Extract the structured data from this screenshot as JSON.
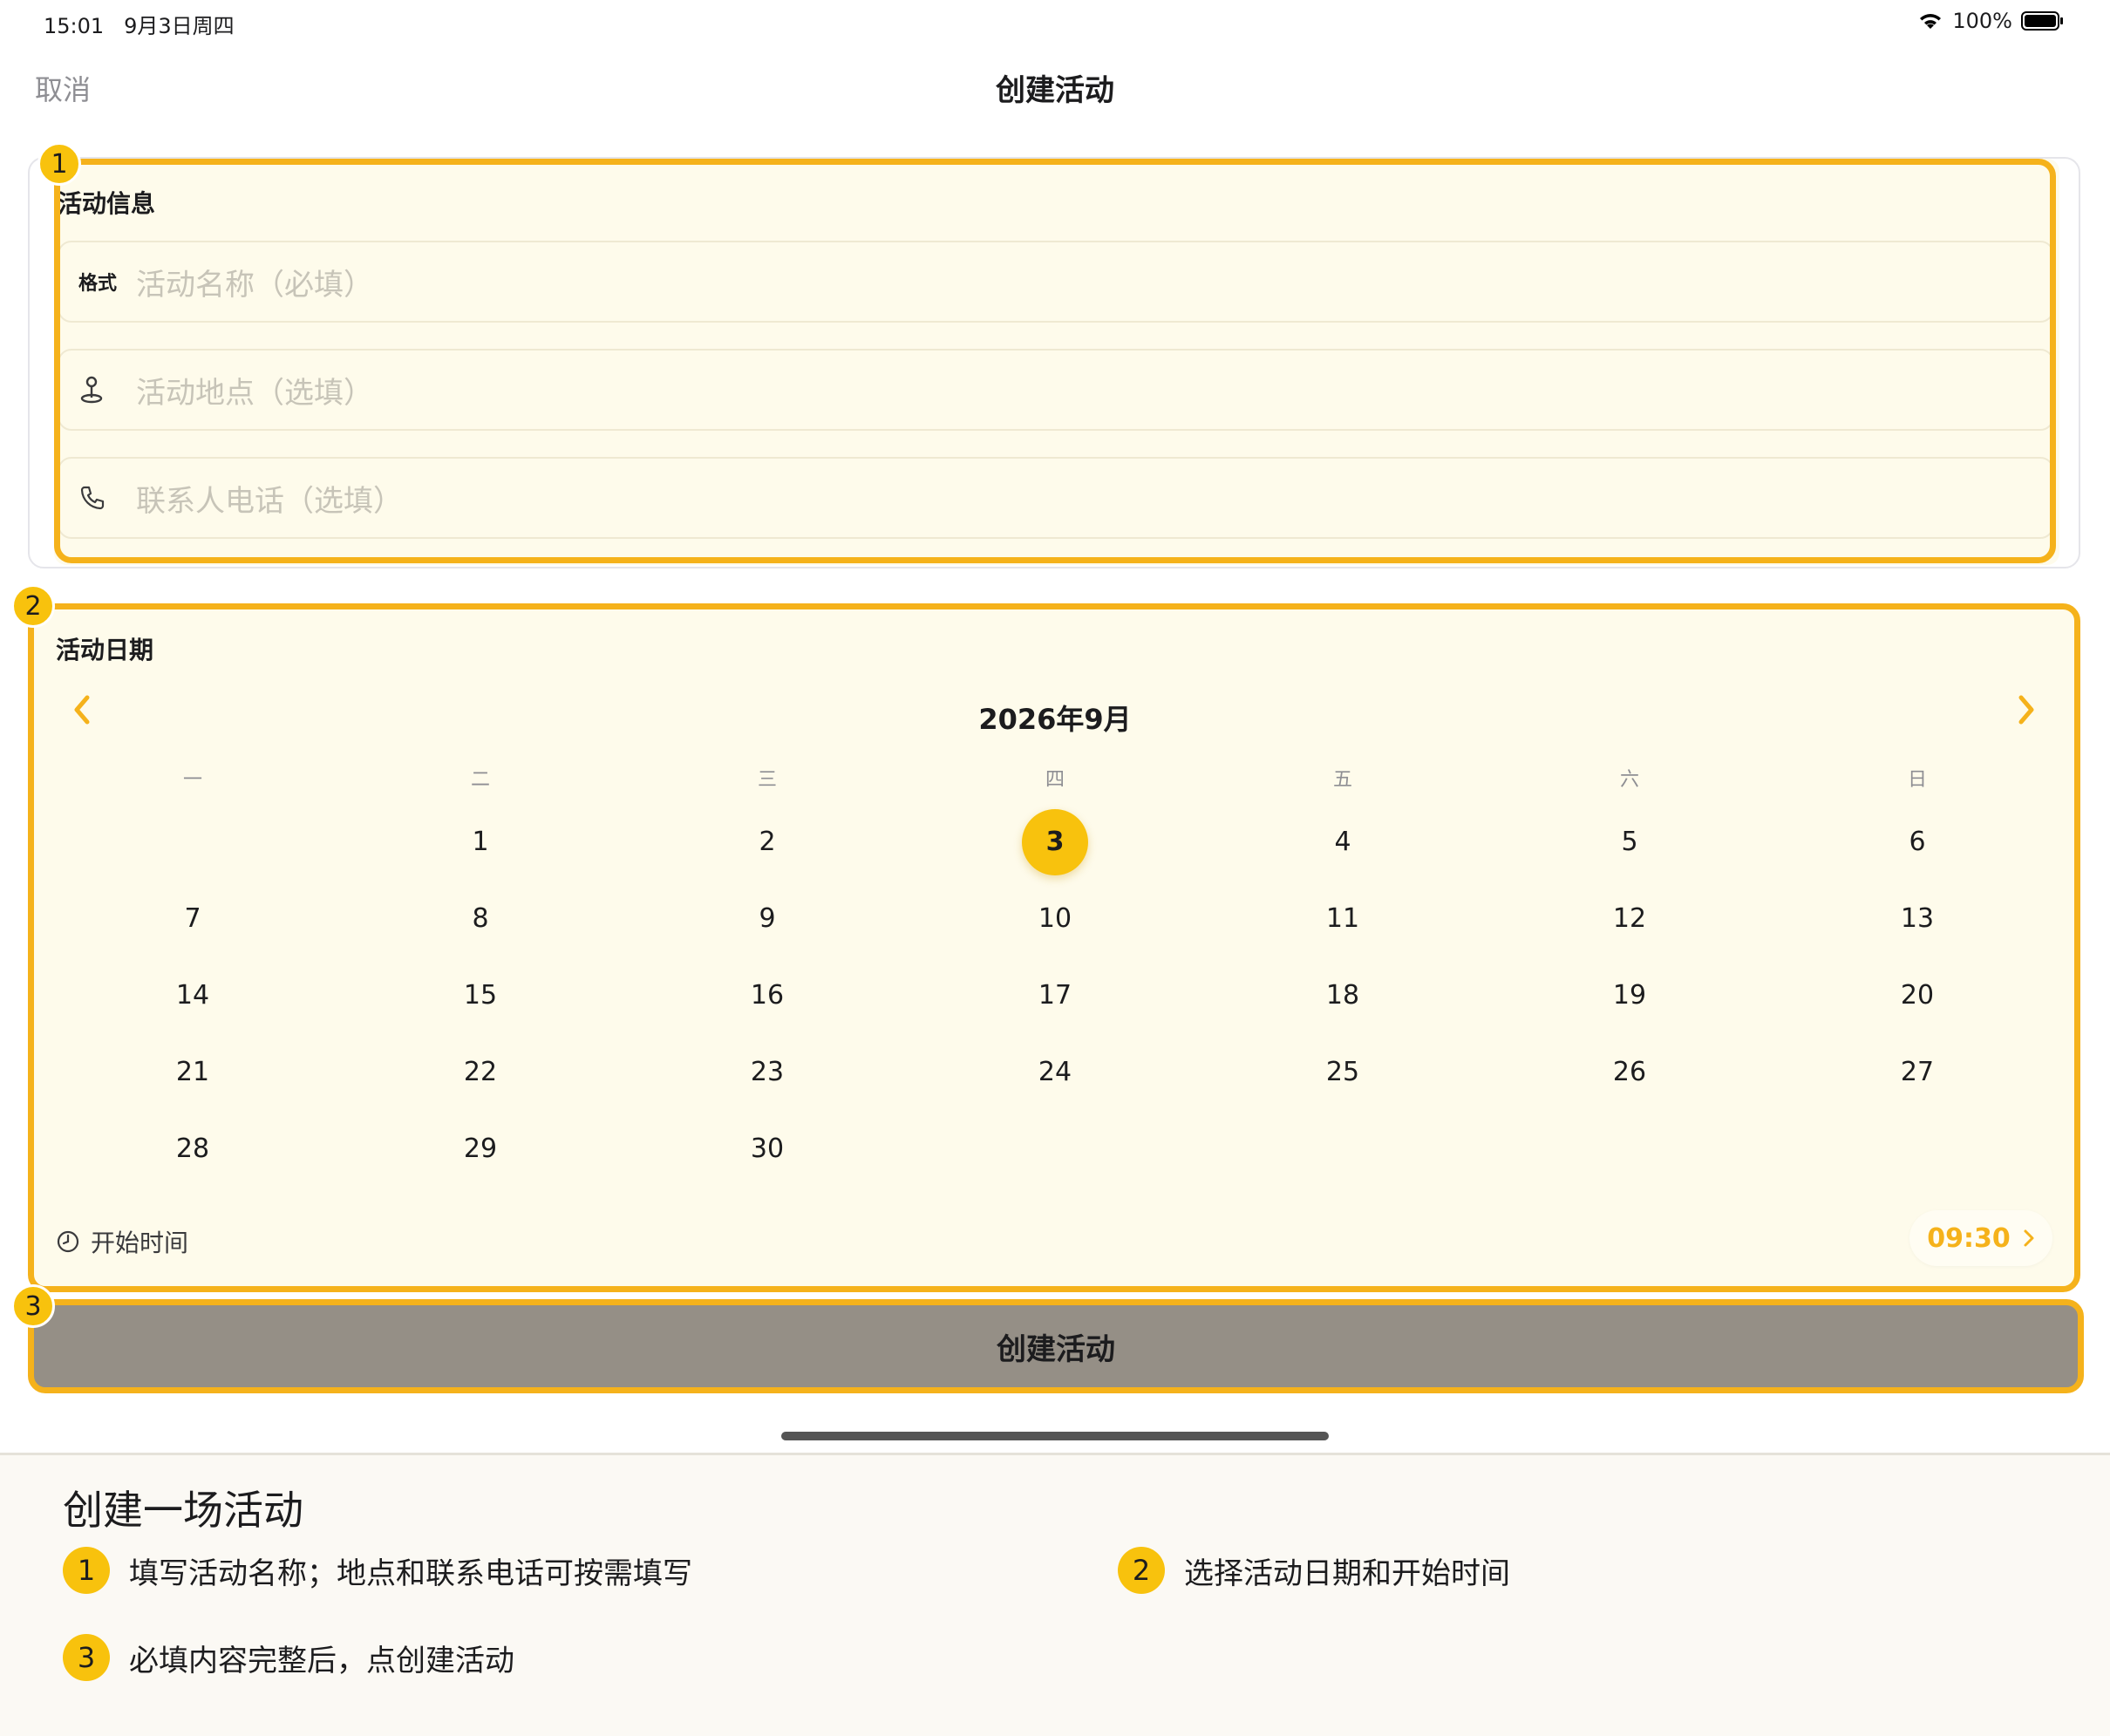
{
  "status_bar": {
    "time": "15:01",
    "date": "9月3日周四",
    "battery": "100%"
  },
  "nav": {
    "cancel": "取消",
    "title": "创建活动"
  },
  "info_section": {
    "title": "活动信息",
    "name_field": {
      "label": "格式",
      "placeholder": "活动名称（必填）"
    },
    "location_field": {
      "placeholder": "活动地点（选填）",
      "icon": "location-pin-icon"
    },
    "phone_field": {
      "placeholder": "联系人电话（选填）",
      "icon": "phone-icon"
    }
  },
  "date_section": {
    "title": "活动日期",
    "month_label": "2026年9月",
    "weekdays": [
      "一",
      "二",
      "三",
      "四",
      "五",
      "六",
      "日"
    ],
    "weeks": [
      [
        "",
        "1",
        "2",
        "3",
        "4",
        "5",
        "6"
      ],
      [
        "7",
        "8",
        "9",
        "10",
        "11",
        "12",
        "13"
      ],
      [
        "14",
        "15",
        "16",
        "17",
        "18",
        "19",
        "20"
      ],
      [
        "21",
        "22",
        "23",
        "24",
        "25",
        "26",
        "27"
      ],
      [
        "28",
        "29",
        "30",
        "",
        "",
        "",
        ""
      ]
    ],
    "selected_day": "3",
    "start_time_label": "开始时间",
    "start_time_value": "09:30"
  },
  "create_button": "创建活动",
  "markers": [
    "1",
    "2",
    "3"
  ],
  "instructions": {
    "title": "创建一场活动",
    "items": [
      {
        "num": "1",
        "text": "填写活动名称；地点和联系电话可按需填写"
      },
      {
        "num": "2",
        "text": "选择活动日期和开始时间"
      },
      {
        "num": "3",
        "text": "必填内容完整后，点创建活动"
      }
    ]
  },
  "colors": {
    "accent": "#f5b21b",
    "selected": "#f8c20d",
    "button": "#958f86",
    "card_bg": "#fefbeb"
  }
}
